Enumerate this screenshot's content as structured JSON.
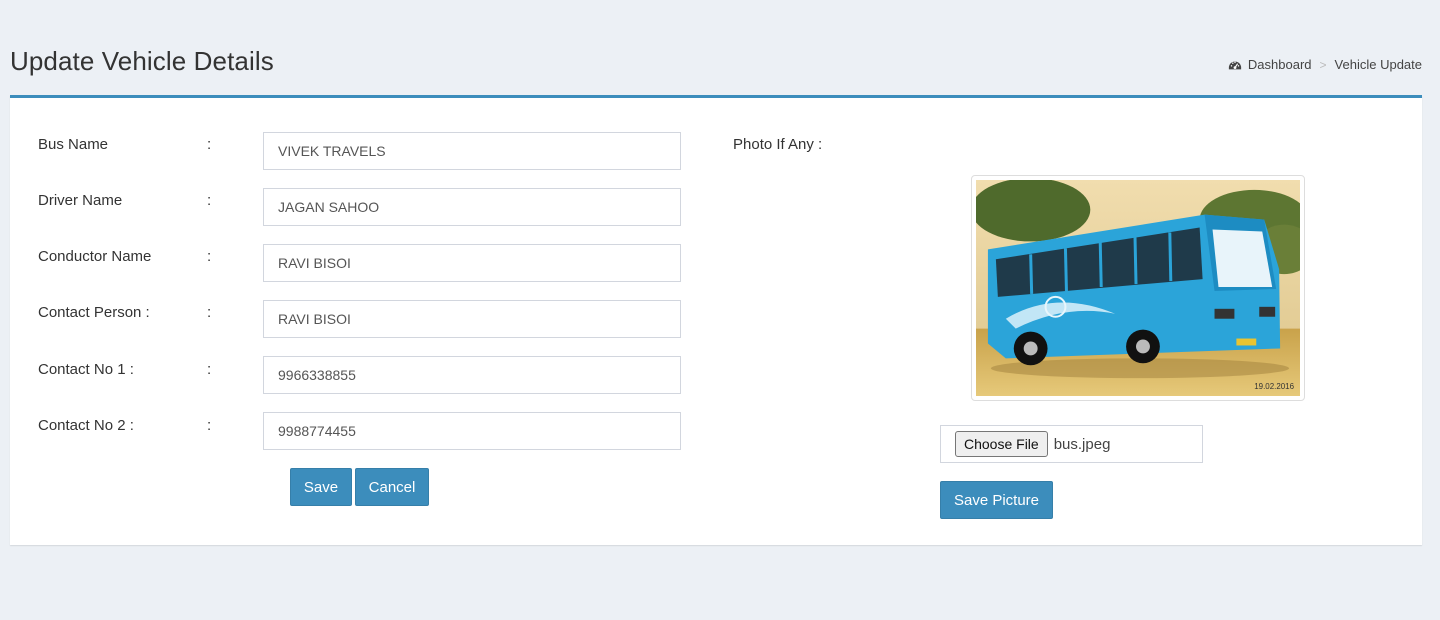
{
  "header": {
    "title": "Update Vehicle Details",
    "breadcrumb": [
      {
        "label": "Dashboard",
        "icon": "dashboard-icon"
      },
      {
        "label": "Vehicle Update"
      }
    ],
    "breadcrumb_separator": ">"
  },
  "form": {
    "separator": ":",
    "fields": [
      {
        "label": "Bus Name",
        "value": "VIVEK TRAVELS"
      },
      {
        "label": "Driver Name",
        "value": "JAGAN SAHOO"
      },
      {
        "label": "Conductor Name",
        "value": "RAVI BISOI"
      },
      {
        "label": "Contact Person :",
        "value": "RAVI BISOI"
      },
      {
        "label": "Contact No 1 :",
        "value": "9966338855"
      },
      {
        "label": "Contact No 2 :",
        "value": "9988774455"
      }
    ],
    "save_label": "Save",
    "cancel_label": "Cancel"
  },
  "photo": {
    "label": "Photo If Any :",
    "image_date_stamp": "19.02.2016",
    "choose_file_label": "Choose File",
    "file_name": "bus.jpeg",
    "save_picture_label": "Save Picture"
  },
  "colors": {
    "primary": "#3c8dbc",
    "background": "#ecf0f5",
    "bus_body": "#2ba4d9"
  }
}
